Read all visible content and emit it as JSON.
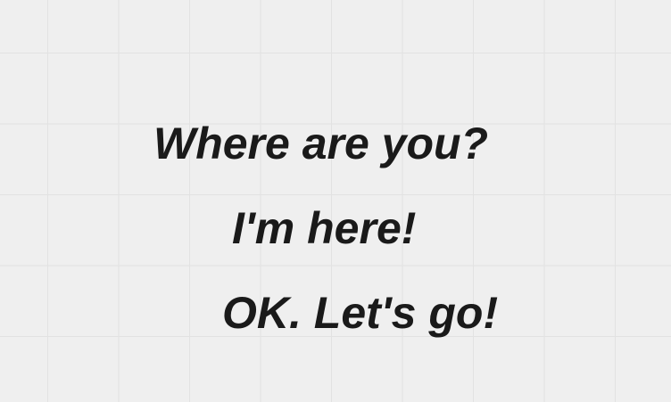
{
  "messages": [
    "Where are you?",
    "I'm here!",
    "OK. Let's go!"
  ],
  "colors": {
    "background": "#efefef",
    "grid": "#e2e2e2",
    "text": "#1a1a1a"
  }
}
